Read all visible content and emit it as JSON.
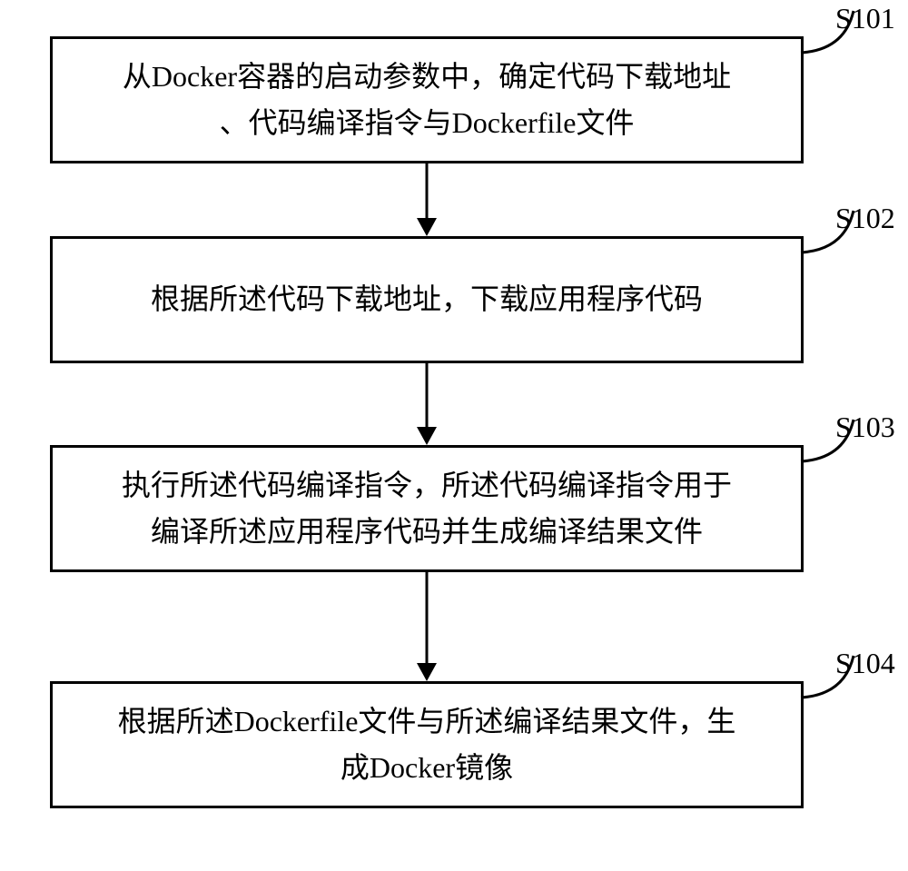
{
  "steps": [
    {
      "id": "S101",
      "text": "从Docker容器的启动参数中，确定代码下载地址\n、代码编译指令与Dockerfile文件"
    },
    {
      "id": "S102",
      "text": "根据所述代码下载地址，下载应用程序代码"
    },
    {
      "id": "S103",
      "text": "执行所述代码编译指令，所述代码编译指令用于\n编译所述应用程序代码并生成编译结果文件"
    },
    {
      "id": "S104",
      "text": "根据所述Dockerfile文件与所述编译结果文件，生\n成Docker镜像"
    }
  ]
}
